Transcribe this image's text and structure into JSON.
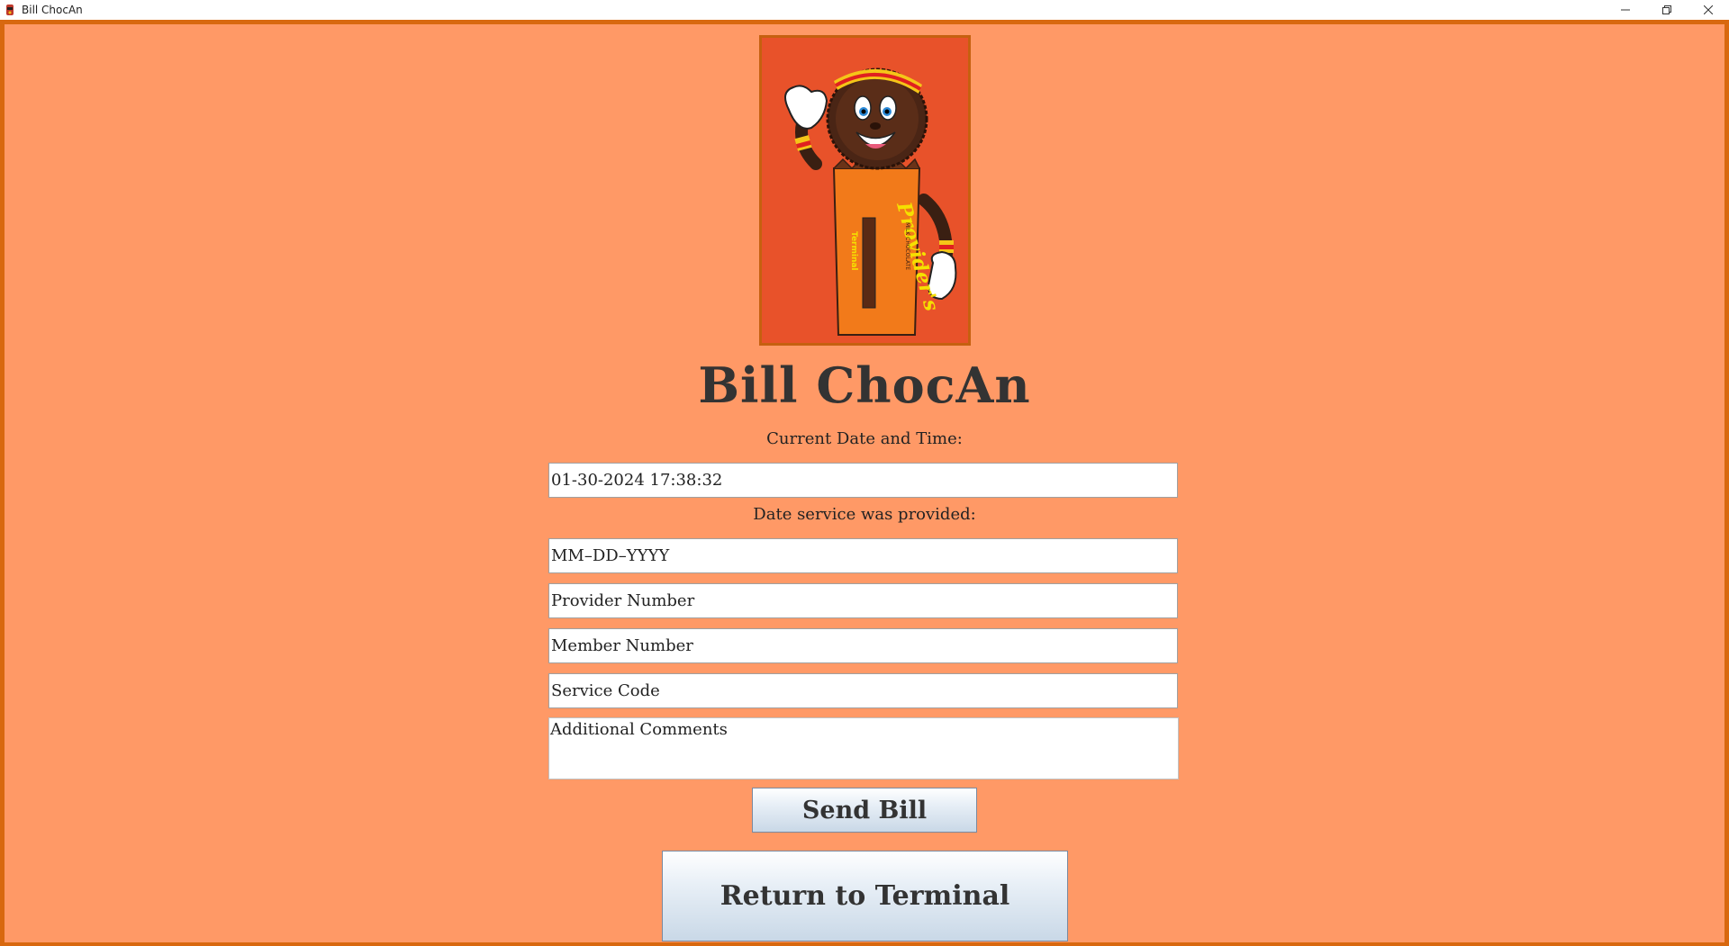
{
  "window": {
    "title": "Bill ChocAn"
  },
  "logo": {
    "alt": "Provider's Terminal candy mascot logo",
    "wrapper_text": "Provider's",
    "wrapper_subtext": "Terminal",
    "wrapper_small": "MILK CHOCOLATE"
  },
  "page": {
    "title": "Bill ChocAn"
  },
  "form": {
    "current_datetime_label": "Current Date and Time:",
    "current_datetime_value": "01-30-2024 17:38:32",
    "service_date_label": "Date service was provided:",
    "service_date_placeholder": "MM–DD–YYYY",
    "provider_number_placeholder": "Provider Number",
    "member_number_placeholder": "Member Number",
    "service_code_placeholder": "Service Code",
    "comments_placeholder": "Additional Comments"
  },
  "buttons": {
    "send_bill": "Send Bill",
    "return_terminal": "Return to Terminal"
  },
  "colors": {
    "background": "#ff9966",
    "frame_border": "#d8680f",
    "logo_background": "#e8522a",
    "title_text": "#333333"
  }
}
